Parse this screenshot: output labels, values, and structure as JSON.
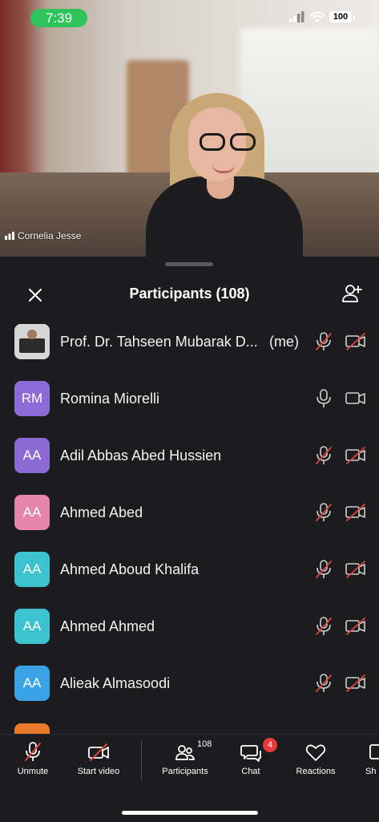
{
  "status_bar": {
    "time": "7:39",
    "battery": "100"
  },
  "video": {
    "speaker_name": "Cornelia Jesse"
  },
  "panel": {
    "title": "Participants (108)"
  },
  "participants": [
    {
      "name": "Prof. Dr. Tahseen Mubarak D...",
      "suffix": "(me)",
      "initials": "",
      "avatar_color": "#cfcfcf",
      "mic_muted": true,
      "video_off": true
    },
    {
      "name": "Romina Miorelli",
      "suffix": "",
      "initials": "RM",
      "avatar_color": "#8c6bd6",
      "mic_muted": false,
      "video_off": false
    },
    {
      "name": "Adil Abbas Abed Hussien",
      "suffix": "",
      "initials": "AA",
      "avatar_color": "#8a6ad3",
      "mic_muted": true,
      "video_off": true
    },
    {
      "name": "Ahmed Abed",
      "suffix": "",
      "initials": "AA",
      "avatar_color": "#e584ad",
      "mic_muted": true,
      "video_off": true
    },
    {
      "name": "Ahmed Aboud Khalifa",
      "suffix": "",
      "initials": "AA",
      "avatar_color": "#3cc3cf",
      "mic_muted": true,
      "video_off": true
    },
    {
      "name": "Ahmed Ahmed",
      "suffix": "",
      "initials": "AA",
      "avatar_color": "#3cc3cf",
      "mic_muted": true,
      "video_off": true
    },
    {
      "name": "Alieak Almasoodi",
      "suffix": "",
      "initials": "AA",
      "avatar_color": "#3aa3e6",
      "mic_muted": true,
      "video_off": true
    }
  ],
  "toolbar": {
    "unmute": "Unmute",
    "start_video": "Start video",
    "participants": "Participants",
    "participants_count": "108",
    "chat": "Chat",
    "chat_badge": "4",
    "reactions": "Reactions",
    "share": "Sh"
  },
  "colors": {
    "accent_green": "#2ec45a",
    "badge_red": "#e5393b",
    "muted_red": "#e0443e"
  }
}
